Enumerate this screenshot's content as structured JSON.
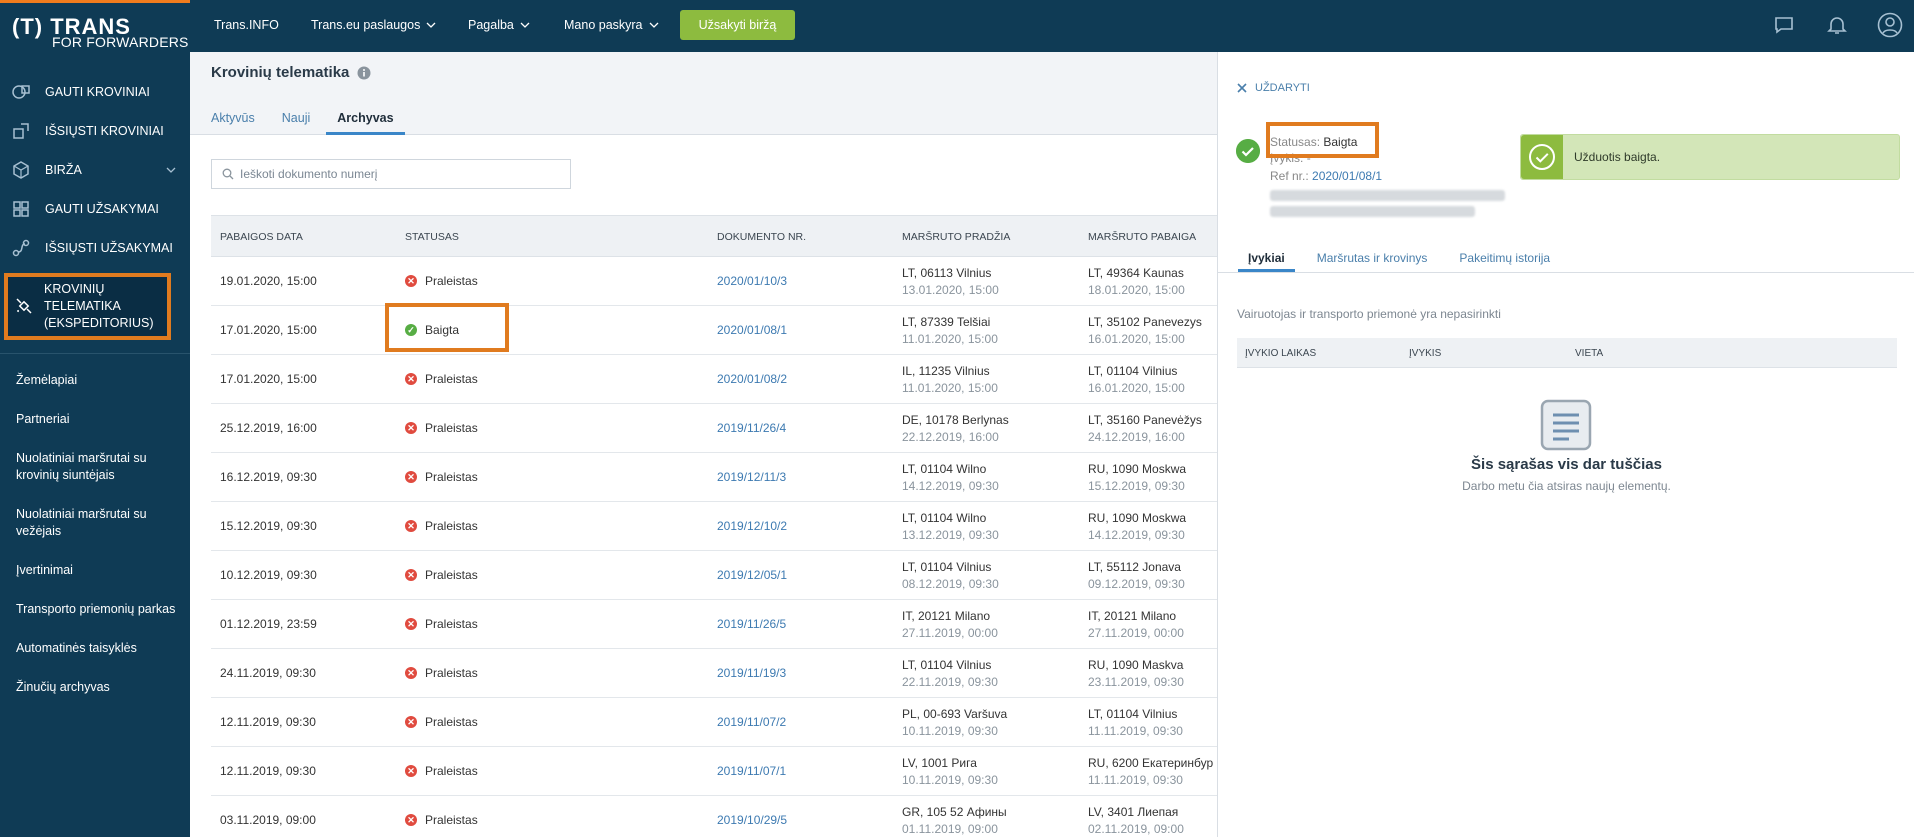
{
  "app": {
    "logo_big": "(T) TRANS",
    "logo_small": "FOR FORWARDERS"
  },
  "topbar": {
    "links": [
      {
        "label": "Trans.INFO"
      },
      {
        "label": "Trans.eu paslaugos"
      },
      {
        "label": "Pagalba"
      },
      {
        "label": "Mano paskyra"
      }
    ],
    "cta_label": "Užsakyti biržą",
    "icons": [
      "chat-icon",
      "bell-icon",
      "user-icon"
    ]
  },
  "sidebar": {
    "main_items": [
      {
        "label": "GAUTI KROVINIAI",
        "icon": "receive-cargo-icon"
      },
      {
        "label": "IŠSIŲSTI KROVINIAI",
        "icon": "send-cargo-icon"
      },
      {
        "label": "BIRŽA",
        "icon": "box-icon"
      },
      {
        "label": "GAUTI UŽSAKYMAI",
        "icon": "grid-icon"
      },
      {
        "label": "IŠSIŲSTI UŽSAKYMAI",
        "icon": "route-icon"
      }
    ],
    "active_item": {
      "line1": "KROVINIŲ",
      "line2": "TELEMATIKA",
      "line3": "(EKSPEDITORIUS)",
      "icon": "satellite-icon"
    },
    "secondary_items": [
      {
        "label": "Žemėlapiai"
      },
      {
        "label": "Partneriai"
      },
      {
        "label": "Nuolatiniai maršrutai su krovinių siuntėjais"
      },
      {
        "label": "Nuolatiniai maršrutai su vežėjais"
      },
      {
        "label": "Įvertinimai"
      },
      {
        "label": "Transporto priemonių parkas"
      },
      {
        "label": "Automatinės taisyklės"
      },
      {
        "label": "Žinučių archyvas"
      }
    ]
  },
  "main": {
    "title": "Krovinių telematika",
    "tabs": [
      {
        "label": "Aktyvūs"
      },
      {
        "label": "Nauji"
      },
      {
        "label": "Archyvas"
      }
    ],
    "active_tab": "Archyvas",
    "search_placeholder": "Ieškoti dokumento numerį",
    "columns": [
      "PABAIGOS DATA",
      "STATUSAS",
      "DOKUMENTO NR.",
      "MARŠRUTO PRADŽIA",
      "MARŠRUTO PABAIGA"
    ],
    "rows": [
      {
        "end_date": "19.01.2020, 15:00",
        "status": "Praleistas",
        "status_kind": "red",
        "doc": "2020/01/10/3",
        "start": "LT, 06113 Vilnius",
        "start_time": "13.01.2020, 15:00",
        "end": "LT, 49364 Kaunas",
        "end_time": "18.01.2020, 15:00"
      },
      {
        "end_date": "17.01.2020, 15:00",
        "status": "Baigta",
        "status_kind": "green",
        "doc": "2020/01/08/1",
        "start": "LT, 87339 Telšiai",
        "start_time": "11.01.2020, 15:00",
        "end": "LT, 35102 Panevezys",
        "end_time": "16.01.2020, 15:00"
      },
      {
        "end_date": "17.01.2020, 15:00",
        "status": "Praleistas",
        "status_kind": "red",
        "doc": "2020/01/08/2",
        "start": "IL, 11235 Vilnius",
        "start_time": "11.01.2020, 15:00",
        "end": "LT, 01104 Vilnius",
        "end_time": "16.01.2020, 15:00"
      },
      {
        "end_date": "25.12.2019, 16:00",
        "status": "Praleistas",
        "status_kind": "red",
        "doc": "2019/11/26/4",
        "start": "DE, 10178 Berlynas",
        "start_time": "22.12.2019, 16:00",
        "end": "LT, 35160 Panevėžys",
        "end_time": "24.12.2019, 16:00"
      },
      {
        "end_date": "16.12.2019, 09:30",
        "status": "Praleistas",
        "status_kind": "red",
        "doc": "2019/12/11/3",
        "start": "LT, 01104 Wilno",
        "start_time": "14.12.2019, 09:30",
        "end": "RU, 1090 Moskwa",
        "end_time": "15.12.2019, 09:30"
      },
      {
        "end_date": "15.12.2019, 09:30",
        "status": "Praleistas",
        "status_kind": "red",
        "doc": "2019/12/10/2",
        "start": "LT, 01104 Wilno",
        "start_time": "13.12.2019, 09:30",
        "end": "RU, 1090 Moskwa",
        "end_time": "14.12.2019, 09:30"
      },
      {
        "end_date": "10.12.2019, 09:30",
        "status": "Praleistas",
        "status_kind": "red",
        "doc": "2019/12/05/1",
        "start": "LT, 01104 Vilnius",
        "start_time": "08.12.2019, 09:30",
        "end": "LT, 55112 Jonava",
        "end_time": "09.12.2019, 09:30"
      },
      {
        "end_date": "01.12.2019, 23:59",
        "status": "Praleistas",
        "status_kind": "red",
        "doc": "2019/11/26/5",
        "start": "IT, 20121 Milano",
        "start_time": "27.11.2019, 00:00",
        "end": "IT, 20121 Milano",
        "end_time": "27.11.2019, 00:00"
      },
      {
        "end_date": "24.11.2019, 09:30",
        "status": "Praleistas",
        "status_kind": "red",
        "doc": "2019/11/19/3",
        "start": "LT, 01104 Vilnius",
        "start_time": "22.11.2019, 09:30",
        "end": "RU, 1090 Maskva",
        "end_time": "23.11.2019, 09:30"
      },
      {
        "end_date": "12.11.2019, 09:30",
        "status": "Praleistas",
        "status_kind": "red",
        "doc": "2019/11/07/2",
        "start": "PL, 00-693 Varšuva",
        "start_time": "10.11.2019, 09:30",
        "end": "LT, 01104 Vilnius",
        "end_time": "11.11.2019, 09:30"
      },
      {
        "end_date": "12.11.2019, 09:30",
        "status": "Praleistas",
        "status_kind": "red",
        "doc": "2019/11/07/1",
        "start": "LV, 1001 Рига",
        "start_time": "10.11.2019, 09:30",
        "end": "RU, 6200 Екатеринбур",
        "end_time": "11.11.2019, 09:30"
      },
      {
        "end_date": "03.11.2019, 09:00",
        "status": "Praleistas",
        "status_kind": "red",
        "doc": "2019/10/29/5",
        "start": "GR, 105 52 Афины",
        "start_time": "01.11.2019, 09:00",
        "end": "LV, 3401 Лиепая",
        "end_time": "02.11.2019, 09:00"
      }
    ]
  },
  "panel": {
    "close_label": "UŽDARYTI",
    "status_label": "Statusas:",
    "status_value": "Baigta",
    "events_label": "Įvykis:",
    "events_value": "-",
    "ref_label": "Ref nr.:",
    "ref_value": "2020/01/08/1",
    "toast_text": "Užduotis baigta.",
    "tabs": [
      {
        "label": "Įvykiai"
      },
      {
        "label": "Maršrutas ir krovinys"
      },
      {
        "label": "Pakeitimų istorija"
      }
    ],
    "active_tab": "Įvykiai",
    "note": "Vairuotojas ir transporto priemonė yra nepasirinkti",
    "columns": [
      "ĮVYKIO LAIKAS",
      "ĮVYKIS",
      "VIETA"
    ],
    "empty_title": "Šis sąrašas vis dar tuščias",
    "empty_subtitle": "Darbo metu čia atsiras naujų elementų."
  },
  "colors": {
    "sidebar": "#0f3b55",
    "accent_orange": "#e07b1f",
    "cta_green": "#8dbb3f",
    "link_blue": "#3d7ab1",
    "status_red": "#e04b3f",
    "status_green": "#57ad44"
  }
}
